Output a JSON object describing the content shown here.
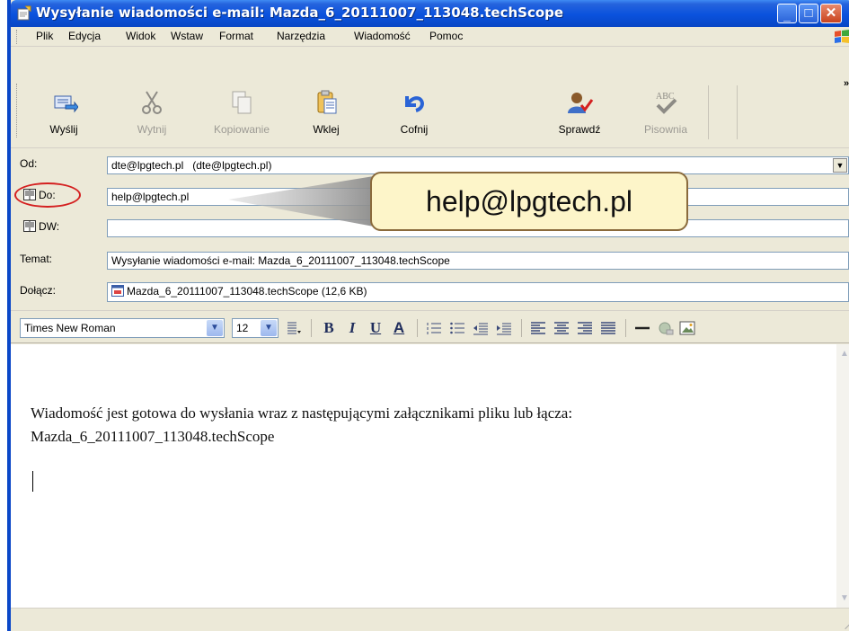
{
  "window": {
    "title": "Wysyłanie wiadomości e-mail: Mazda_6_20111007_113048.techScope"
  },
  "menu": [
    {
      "label": "Plik"
    },
    {
      "label": "Edycja"
    },
    {
      "label": "Widok"
    },
    {
      "label": "Wstaw"
    },
    {
      "label": "Format"
    },
    {
      "label": "Narzędzia"
    },
    {
      "label": "Wiadomość"
    },
    {
      "label": "Pomoc"
    }
  ],
  "toolbar": [
    {
      "label": "Wyślij",
      "icon": "send-icon",
      "enabled": true
    },
    {
      "label": "Wytnij",
      "icon": "scissors-icon",
      "enabled": false
    },
    {
      "label": "Kopiowanie",
      "icon": "copy-icon",
      "enabled": false
    },
    {
      "label": "Wklej",
      "icon": "paste-icon",
      "enabled": true
    },
    {
      "label": "Cofnij",
      "icon": "undo-icon",
      "enabled": true
    },
    {
      "label": "Sprawdź",
      "icon": "check-names-icon",
      "enabled": true
    },
    {
      "label": "Pisownia",
      "icon": "spelling-icon",
      "enabled": false
    }
  ],
  "header": {
    "from_label": "Od:",
    "from_value": "dte@lpgtech.pl   (dte@lpgtech.pl)",
    "to_label": "Do:",
    "to_value": "help@lpgtech.pl",
    "cc_label": "DW:",
    "cc_value": "",
    "subject_label": "Temat:",
    "subject_value": "Wysyłanie wiadomości e-mail: Mazda_6_20111007_113048.techScope",
    "attach_label": "Dołącz:",
    "attach_value": "Mazda_6_20111007_113048.techScope (12,6 KB)"
  },
  "callout": {
    "text": "help@lpgtech.pl"
  },
  "format": {
    "font": "Times New Roman",
    "size": "12"
  },
  "body": {
    "line1": "Wiadomość jest gotowa do wysłania wraz z następującymi załącznikami pliku lub łącza:",
    "line2": "Mazda_6_20111007_113048.techScope"
  },
  "colors": {
    "titlebar": "#0a52dd",
    "oval": "#d42020",
    "callout_fill": "#fdf5c9"
  }
}
